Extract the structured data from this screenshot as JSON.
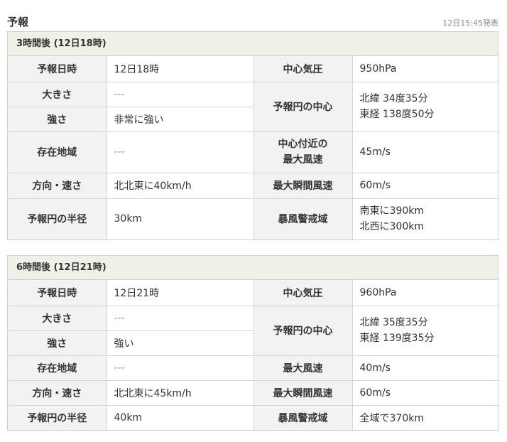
{
  "header": {
    "title": "予報",
    "issued": "12日15:45発表"
  },
  "labels": {
    "forecast_time": "予報日時",
    "size": "大きさ",
    "strength": "強さ",
    "location": "存在地域",
    "direction_speed": "方向・速さ",
    "radius": "予報円の半径",
    "central_pressure": "中心気圧",
    "circle_center": "予報円の中心",
    "max_wind_near_center_line1": "中心付近の",
    "max_wind_near_center_line2": "最大風速",
    "max_wind": "最大風速",
    "max_gust": "最大瞬間風速",
    "storm_area": "暴風警戒域"
  },
  "forecasts": [
    {
      "title": "3時間後 (12日18時)",
      "forecast_time": "12日18時",
      "size": "---",
      "strength": "非常に強い",
      "location": "---",
      "direction_speed": "北北東に40km/h",
      "radius": "30km",
      "central_pressure": "950hPa",
      "center_lat": "北緯 34度35分",
      "center_lon": "東経 138度50分",
      "max_wind": "45m/s",
      "max_gust": "60m/s",
      "storm_area_1": "南東に390km",
      "storm_area_2": "北西に300km"
    },
    {
      "title": "6時間後 (12日21時)",
      "forecast_time": "12日21時",
      "size": "---",
      "strength": "強い",
      "location": "---",
      "direction_speed": "北北東に45km/h",
      "radius": "40km",
      "central_pressure": "960hPa",
      "center_lat": "北緯 35度35分",
      "center_lon": "東経 139度35分",
      "max_wind": "40m/s",
      "max_gust": "60m/s",
      "storm_area_1": "全域で370km"
    }
  ]
}
